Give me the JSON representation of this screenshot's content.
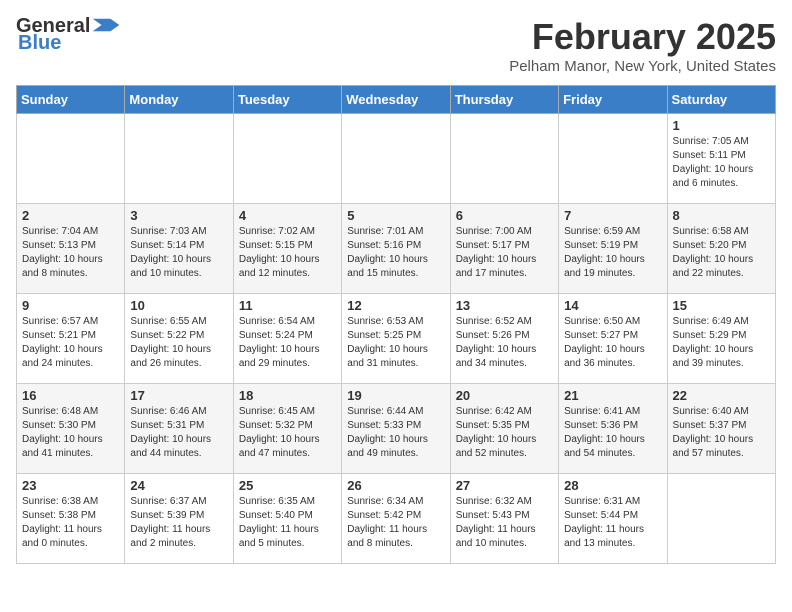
{
  "header": {
    "logo_line1": "General",
    "logo_line2": "Blue",
    "month": "February 2025",
    "location": "Pelham Manor, New York, United States"
  },
  "days_of_week": [
    "Sunday",
    "Monday",
    "Tuesday",
    "Wednesday",
    "Thursday",
    "Friday",
    "Saturday"
  ],
  "weeks": [
    [
      {
        "day": "",
        "info": ""
      },
      {
        "day": "",
        "info": ""
      },
      {
        "day": "",
        "info": ""
      },
      {
        "day": "",
        "info": ""
      },
      {
        "day": "",
        "info": ""
      },
      {
        "day": "",
        "info": ""
      },
      {
        "day": "1",
        "info": "Sunrise: 7:05 AM\nSunset: 5:11 PM\nDaylight: 10 hours\nand 6 minutes."
      }
    ],
    [
      {
        "day": "2",
        "info": "Sunrise: 7:04 AM\nSunset: 5:13 PM\nDaylight: 10 hours\nand 8 minutes."
      },
      {
        "day": "3",
        "info": "Sunrise: 7:03 AM\nSunset: 5:14 PM\nDaylight: 10 hours\nand 10 minutes."
      },
      {
        "day": "4",
        "info": "Sunrise: 7:02 AM\nSunset: 5:15 PM\nDaylight: 10 hours\nand 12 minutes."
      },
      {
        "day": "5",
        "info": "Sunrise: 7:01 AM\nSunset: 5:16 PM\nDaylight: 10 hours\nand 15 minutes."
      },
      {
        "day": "6",
        "info": "Sunrise: 7:00 AM\nSunset: 5:17 PM\nDaylight: 10 hours\nand 17 minutes."
      },
      {
        "day": "7",
        "info": "Sunrise: 6:59 AM\nSunset: 5:19 PM\nDaylight: 10 hours\nand 19 minutes."
      },
      {
        "day": "8",
        "info": "Sunrise: 6:58 AM\nSunset: 5:20 PM\nDaylight: 10 hours\nand 22 minutes."
      }
    ],
    [
      {
        "day": "9",
        "info": "Sunrise: 6:57 AM\nSunset: 5:21 PM\nDaylight: 10 hours\nand 24 minutes."
      },
      {
        "day": "10",
        "info": "Sunrise: 6:55 AM\nSunset: 5:22 PM\nDaylight: 10 hours\nand 26 minutes."
      },
      {
        "day": "11",
        "info": "Sunrise: 6:54 AM\nSunset: 5:24 PM\nDaylight: 10 hours\nand 29 minutes."
      },
      {
        "day": "12",
        "info": "Sunrise: 6:53 AM\nSunset: 5:25 PM\nDaylight: 10 hours\nand 31 minutes."
      },
      {
        "day": "13",
        "info": "Sunrise: 6:52 AM\nSunset: 5:26 PM\nDaylight: 10 hours\nand 34 minutes."
      },
      {
        "day": "14",
        "info": "Sunrise: 6:50 AM\nSunset: 5:27 PM\nDaylight: 10 hours\nand 36 minutes."
      },
      {
        "day": "15",
        "info": "Sunrise: 6:49 AM\nSunset: 5:29 PM\nDaylight: 10 hours\nand 39 minutes."
      }
    ],
    [
      {
        "day": "16",
        "info": "Sunrise: 6:48 AM\nSunset: 5:30 PM\nDaylight: 10 hours\nand 41 minutes."
      },
      {
        "day": "17",
        "info": "Sunrise: 6:46 AM\nSunset: 5:31 PM\nDaylight: 10 hours\nand 44 minutes."
      },
      {
        "day": "18",
        "info": "Sunrise: 6:45 AM\nSunset: 5:32 PM\nDaylight: 10 hours\nand 47 minutes."
      },
      {
        "day": "19",
        "info": "Sunrise: 6:44 AM\nSunset: 5:33 PM\nDaylight: 10 hours\nand 49 minutes."
      },
      {
        "day": "20",
        "info": "Sunrise: 6:42 AM\nSunset: 5:35 PM\nDaylight: 10 hours\nand 52 minutes."
      },
      {
        "day": "21",
        "info": "Sunrise: 6:41 AM\nSunset: 5:36 PM\nDaylight: 10 hours\nand 54 minutes."
      },
      {
        "day": "22",
        "info": "Sunrise: 6:40 AM\nSunset: 5:37 PM\nDaylight: 10 hours\nand 57 minutes."
      }
    ],
    [
      {
        "day": "23",
        "info": "Sunrise: 6:38 AM\nSunset: 5:38 PM\nDaylight: 11 hours\nand 0 minutes."
      },
      {
        "day": "24",
        "info": "Sunrise: 6:37 AM\nSunset: 5:39 PM\nDaylight: 11 hours\nand 2 minutes."
      },
      {
        "day": "25",
        "info": "Sunrise: 6:35 AM\nSunset: 5:40 PM\nDaylight: 11 hours\nand 5 minutes."
      },
      {
        "day": "26",
        "info": "Sunrise: 6:34 AM\nSunset: 5:42 PM\nDaylight: 11 hours\nand 8 minutes."
      },
      {
        "day": "27",
        "info": "Sunrise: 6:32 AM\nSunset: 5:43 PM\nDaylight: 11 hours\nand 10 minutes."
      },
      {
        "day": "28",
        "info": "Sunrise: 6:31 AM\nSunset: 5:44 PM\nDaylight: 11 hours\nand 13 minutes."
      },
      {
        "day": "",
        "info": ""
      }
    ]
  ]
}
